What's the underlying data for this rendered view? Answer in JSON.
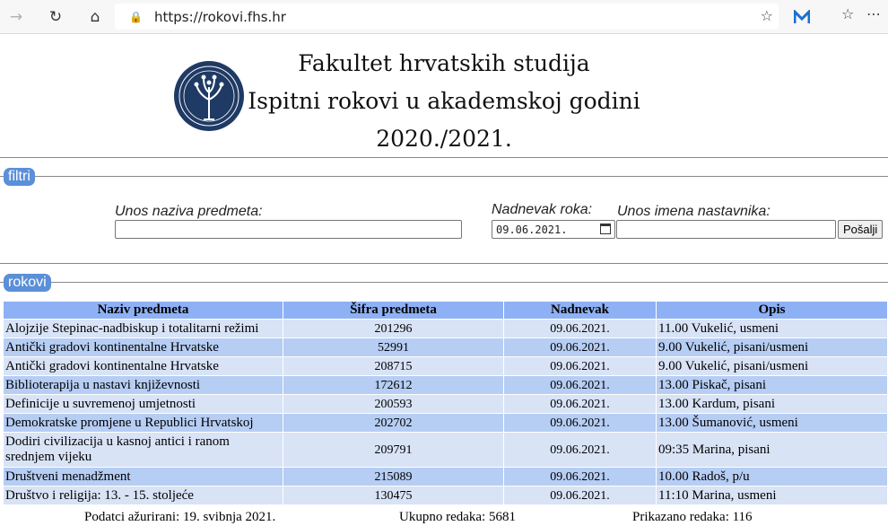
{
  "browser": {
    "url": "https://rokovi.fhs.hr"
  },
  "header": {
    "line1": "Fakultet hrvatskih studija",
    "line2": "Ispitni rokovi u akademskoj godini",
    "line3": "2020./2021."
  },
  "filters": {
    "legend": "filtri",
    "subject_label": "Unos naziva predmeta:",
    "subject_value": "",
    "date_label": "Nadnevak roka:",
    "date_value": "09.06.2021.",
    "teacher_label": "Unos imena nastavnika:",
    "teacher_value": "",
    "submit_label": "Pošalji"
  },
  "results": {
    "legend": "rokovi",
    "columns": [
      "Naziv predmeta",
      "Šifra predmeta",
      "Nadnevak",
      "Opis"
    ],
    "rows": [
      [
        "Alojzije Stepinac-nadbiskup i totalitarni režimi",
        "201296",
        "09.06.2021.",
        "11.00 Vukelić, usmeni"
      ],
      [
        "Antički gradovi kontinentalne Hrvatske",
        "52991",
        "09.06.2021.",
        "9.00 Vukelić, pisani/usmeni"
      ],
      [
        "Antički gradovi kontinentalne Hrvatske",
        "208715",
        "09.06.2021.",
        "9.00 Vukelić, pisani/usmeni"
      ],
      [
        "Biblioterapija u nastavi književnosti",
        "172612",
        "09.06.2021.",
        "13.00 Piskač, pisani"
      ],
      [
        "Definicije u suvremenoj umjetnosti",
        "200593",
        "09.06.2021.",
        "13.00 Kardum, pisani"
      ],
      [
        "Demokratske promjene u Republici Hrvatskoj",
        "202702",
        "09.06.2021.",
        "13.00 Šumanović, usmeni"
      ],
      [
        "Dodiri civilizacija u kasnoj antici i ranom srednjem vijeku",
        "209791",
        "09.06.2021.",
        "09:35 Marina, pisani"
      ],
      [
        "Društveni menadžment",
        "215089",
        "09.06.2021.",
        "10.00 Radoš, p/u"
      ],
      [
        "Društvo i religija: 13. - 15. stoljeće",
        "130475",
        "09.06.2021.",
        "11:10 Marina, usmeni"
      ]
    ]
  },
  "footer": {
    "updated": "Podatci ažurirani: 19. svibnja 2021.",
    "total": "Ukupno redaka: 5681",
    "shown": "Prikazano redaka: 116"
  }
}
